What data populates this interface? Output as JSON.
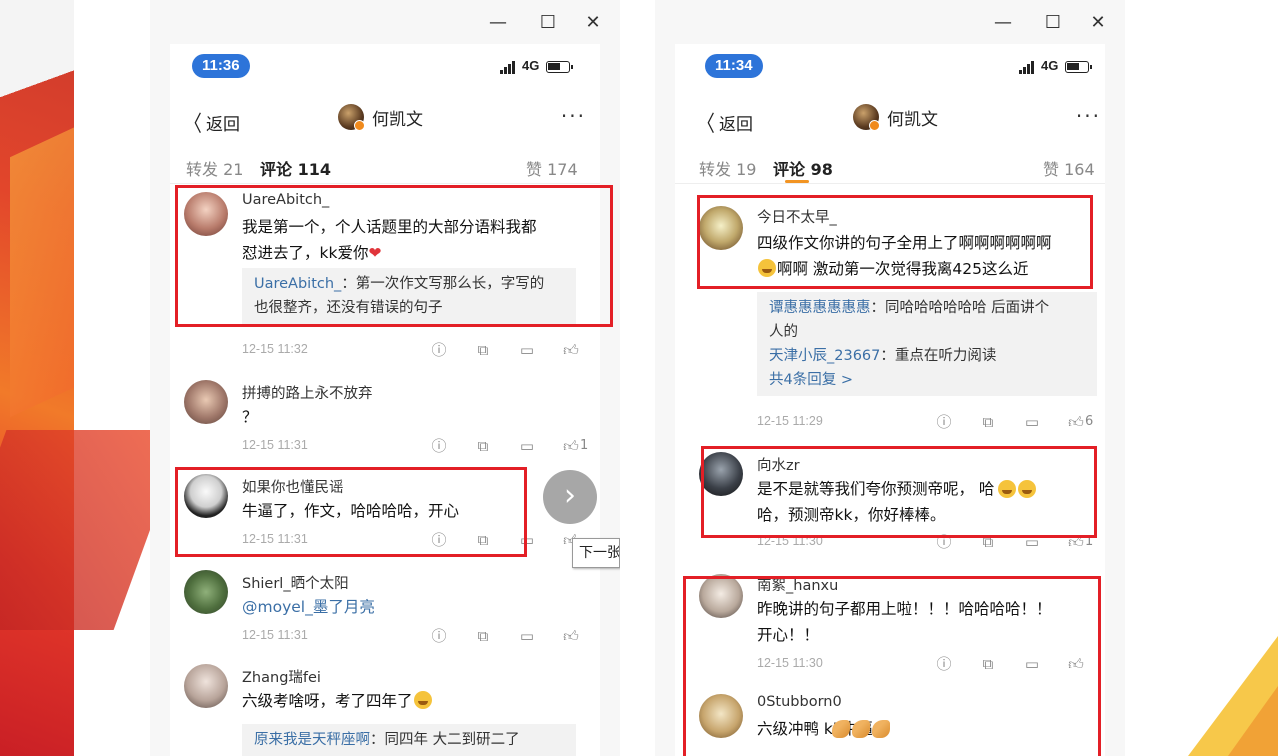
{
  "left": {
    "window_controls": {
      "minimize": "—",
      "maximize": "☐",
      "close": "✕"
    },
    "status": {
      "time": "11:36",
      "network": "4G"
    },
    "nav": {
      "back": "返回",
      "title": "何凯文",
      "more": "···"
    },
    "tabs": {
      "repost": "转发 21",
      "comments": "评论 114",
      "likes": "赞 174"
    },
    "comments": [
      {
        "user": "UareAbitch_",
        "text_lines": [
          "我是第一个，个人话题里的大部分语料我都",
          "怼进去了，kk爱你"
        ],
        "reply_user": "UareAbitch_",
        "reply_lines": [
          "：第一次作文写那么长，字写的",
          "也很整齐，还没有错误的句子"
        ],
        "date": "12-15 11:32",
        "like_count": ""
      },
      {
        "user": "拼搏的路上永不放弃",
        "text_lines": [
          "？"
        ],
        "date": "12-15 11:31",
        "like_count": "1"
      },
      {
        "user": "如果你也懂民谣",
        "text_lines": [
          "牛逼了，作文，哈哈哈哈，开心"
        ],
        "date": "12-15 11:31",
        "like_count": ""
      },
      {
        "user": "Shierl_晒个太阳",
        "text_lines": [
          "@moyel_墨了月亮"
        ],
        "date": "12-15 11:31",
        "like_count": ""
      },
      {
        "user": "Zhang瑞fei",
        "text_lines": [
          "六级考啥呀，考了四年了"
        ],
        "reply_user": "原来我是天秤座啊",
        "reply_lines": [
          "：同四年 大二到研二了"
        ],
        "date": "",
        "like_count": ""
      }
    ],
    "next_arrow": "›",
    "tooltip": "下一张"
  },
  "right": {
    "window_controls": {
      "minimize": "—",
      "maximize": "☐",
      "close": "✕"
    },
    "status": {
      "time": "11:34",
      "network": "4G"
    },
    "nav": {
      "back": "返回",
      "title": "何凯文",
      "more": "···"
    },
    "tabs": {
      "repost": "转发 19",
      "comments": "评论 98",
      "likes": "赞 164"
    },
    "comments": [
      {
        "user": "今日不太早_",
        "text_lines": [
          "四级作文你讲的句子全用上了啊啊啊啊啊啊",
          "啊啊  激动第一次觉得我离425这么近"
        ],
        "replies": [
          {
            "user": "谭惠惠惠惠惠惠",
            "text": "：同哈哈哈哈哈哈  后面讲个",
            "text2": "人的"
          },
          {
            "user": "天津小辰_23667",
            "text": "：重点在听力阅读"
          }
        ],
        "more_replies": "共4条回复 >",
        "date": "12-15 11:29",
        "like_count": "6"
      },
      {
        "user": "向水zr",
        "text_lines": [
          "是不是就等我们夸你预测帝呢，    哈",
          "哈，预测帝kk，你好棒棒。"
        ],
        "date": "12-15 11:30",
        "like_count": "1"
      },
      {
        "user": "南絮_hanxu",
        "text_lines": [
          "昨晚讲的句子都用上啦！！！哈哈哈哈！！",
          "开心！！"
        ],
        "date": "12-15 11:30",
        "like_count": ""
      },
      {
        "user": "0Stubborn0",
        "text_lines": [
          "六级冲鸭       kk牛逼"
        ],
        "date": "",
        "like_count": ""
      }
    ]
  },
  "colors": {
    "accent": "#f29423",
    "highlight": "#e31f26",
    "link": "#3b6fa6",
    "time_pill": "#2d74d9"
  }
}
